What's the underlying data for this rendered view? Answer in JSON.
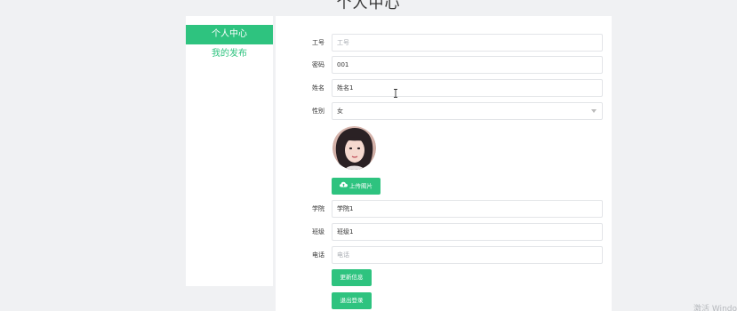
{
  "page": {
    "title": "个人中心"
  },
  "sidebar": {
    "items": [
      {
        "label": "个人中心",
        "active": true
      },
      {
        "label": "我的发布",
        "active": false
      }
    ]
  },
  "form": {
    "employee_id": {
      "label": "工号",
      "value": "",
      "placeholder": "工号"
    },
    "password": {
      "label": "密码",
      "value": "001"
    },
    "name": {
      "label": "姓名",
      "value": "姓名1"
    },
    "gender": {
      "label": "性别",
      "value": "女"
    },
    "upload_button": "上传图片",
    "college": {
      "label": "学院",
      "value": "学院1"
    },
    "class": {
      "label": "班级",
      "value": "班级1"
    },
    "phone": {
      "label": "电话",
      "value": "",
      "placeholder": "电话"
    },
    "update_button": "更新信息",
    "logout_button": "退出登录"
  },
  "watermark": "激活 Windo",
  "colors": {
    "accent": "#2ec37f",
    "background": "#f0f1f3"
  }
}
